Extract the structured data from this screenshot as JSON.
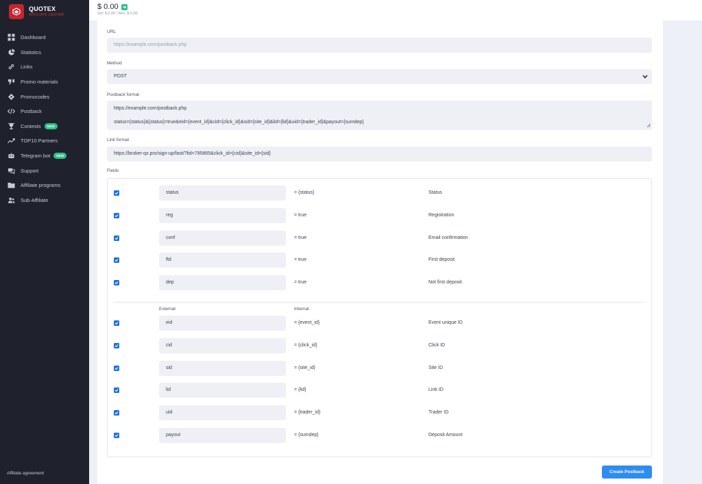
{
  "brand": {
    "name": "QUOTEX",
    "subtitle": "AFFILIATE CENTER"
  },
  "header": {
    "balance": "$ 0.00",
    "balance_sub": "Vol: $ 0.00 / Rev: $ 0.00"
  },
  "sidebar": {
    "items": [
      {
        "label": "Dashboard",
        "icon": "grid-icon"
      },
      {
        "label": "Statistics",
        "icon": "pie-chart-icon"
      },
      {
        "label": "Links",
        "icon": "link-icon"
      },
      {
        "label": "Promo materials",
        "icon": "quote-icon"
      },
      {
        "label": "Promocodes",
        "icon": "ticket-icon"
      },
      {
        "label": "Postback",
        "icon": "code-icon"
      },
      {
        "label": "Contests",
        "icon": "trophy-icon",
        "badge": "NEW"
      },
      {
        "label": "TOP10 Partners",
        "icon": "trend-icon"
      },
      {
        "label": "Telegram bot",
        "icon": "robot-icon",
        "badge": "NEW"
      },
      {
        "label": "Support",
        "icon": "chat-icon"
      },
      {
        "label": "Affiliate programs",
        "icon": "folder-icon"
      },
      {
        "label": "Sub-Affiliate",
        "icon": "users-icon"
      }
    ],
    "footer": "Affiliate agreement"
  },
  "form": {
    "url_label": "URL",
    "url_placeholder": "https://example.com/postback.php",
    "method_label": "Method",
    "method_value": "POST",
    "postback_format_label": "Postback format",
    "postback_format_line1": "https://example.com/postback.php",
    "postback_format_line2": "status={status}&{status}=true&eid={event_id}&cid={click_id}&sid={site_id}&lid={lid}&uid={trader_id}&payout={sumdep}",
    "link_format_label": "Link format",
    "link_format_value": "https://broker-qx.pro/sign-up/fast/?lid=795865&click_id={cid}&site_id={sid}",
    "fields_label": "Fields"
  },
  "fields": {
    "status_rows": [
      {
        "external": "status",
        "internal": "= {status}",
        "description": "Status",
        "checked": true
      },
      {
        "external": "reg",
        "internal": "= true",
        "description": "Registration",
        "checked": true
      },
      {
        "external": "conf",
        "internal": "= true",
        "description": "Email confirmation",
        "checked": true
      },
      {
        "external": "ftd",
        "internal": "= true",
        "description": "First deposit",
        "checked": true
      },
      {
        "external": "dep",
        "internal": "= true",
        "description": "Not first deposit",
        "checked": true
      }
    ],
    "col_external": "External",
    "col_internal": "Internal",
    "param_rows": [
      {
        "external": "eid",
        "internal": "= {event_id}",
        "description": "Event unique ID",
        "checked": true
      },
      {
        "external": "cid",
        "internal": "= {click_id}",
        "description": "Click ID",
        "checked": true
      },
      {
        "external": "sid",
        "internal": "= {site_id}",
        "description": "Site ID",
        "checked": true
      },
      {
        "external": "lid",
        "internal": "= {lid}",
        "description": "Link ID",
        "checked": true
      },
      {
        "external": "uid",
        "internal": "= {trader_id}",
        "description": "Trader ID",
        "checked": true
      },
      {
        "external": "payout",
        "internal": "= {sumdep}",
        "description": "Deposit Amount",
        "checked": true
      }
    ]
  },
  "actions": {
    "create_label": "Create Postback"
  },
  "colors": {
    "sidebar": "#1f222c",
    "accent": "#2f8cf0",
    "checkbox": "#1a73e8",
    "badge": "#2fc18a",
    "brand": "#c4252e"
  }
}
